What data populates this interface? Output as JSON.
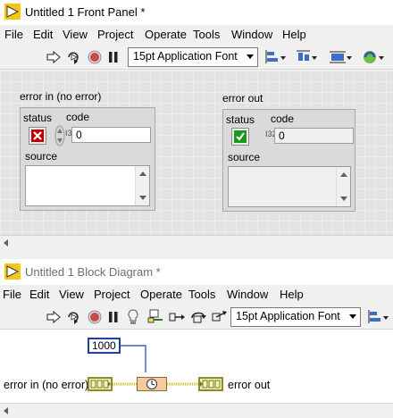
{
  "front_panel": {
    "title": "Untitled 1 Front Panel *",
    "menu": [
      "File",
      "Edit",
      "View",
      "Project",
      "Operate",
      "Tools",
      "Window",
      "Help"
    ],
    "font": "15pt Application Font",
    "error_in": {
      "label": "error in (no error)",
      "status_label": "status",
      "code_label": "code",
      "code_value": "0",
      "source_label": "source",
      "source_value": ""
    },
    "error_out": {
      "label": "error out",
      "status_label": "status",
      "code_label": "code",
      "code_value": "0",
      "source_label": "source",
      "source_value": ""
    }
  },
  "block_diagram": {
    "title": "Untitled 1 Block Diagram *",
    "menu": [
      "File",
      "Edit",
      "View",
      "Project",
      "Operate",
      "Tools",
      "Window",
      "Help"
    ],
    "font": "15pt Application Font",
    "constant": "1000",
    "error_in_label": "error in (no error)",
    "error_out_label": "error out"
  },
  "colors": {
    "error_wire": "#c9c32a",
    "numeric_wire": "#1e3fa8",
    "status_false": "#c00000",
    "status_true": "#1a9a1a"
  }
}
